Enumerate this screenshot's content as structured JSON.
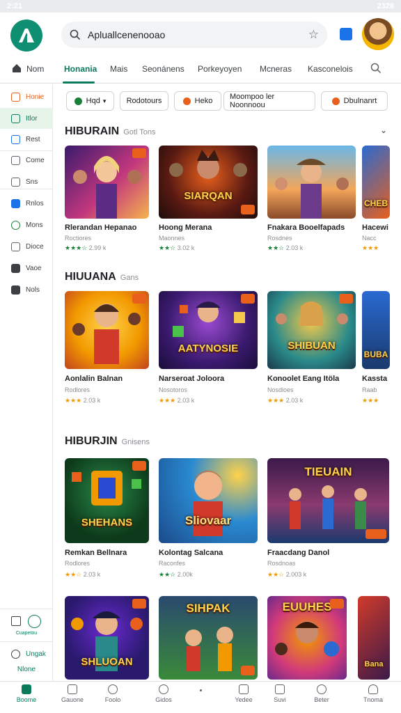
{
  "status": {
    "time": "2:21",
    "right": "2328"
  },
  "search": {
    "placeholder": "Apluallcenenooao"
  },
  "tabs": [
    {
      "label": "Nom"
    },
    {
      "label": "Honania"
    },
    {
      "label": "Mais"
    },
    {
      "label": "Seonánens"
    },
    {
      "label": "Porkeyoyen"
    },
    {
      "label": "Mcneras"
    },
    {
      "label": "Kasconelois"
    }
  ],
  "sidebar": {
    "items": [
      {
        "label": "Honie"
      },
      {
        "label": "Itlor"
      },
      {
        "label": "Rest"
      },
      {
        "label": "Come"
      },
      {
        "label": "Sns"
      },
      {
        "label": "Rnlos"
      },
      {
        "label": "Mons"
      },
      {
        "label": "Dioce"
      },
      {
        "label": "Vaoe"
      },
      {
        "label": "Nols"
      }
    ],
    "footer_top": "Cuapetou",
    "footer_mid": "Ungak",
    "footer_bot": "Nlone"
  },
  "chips": [
    {
      "label": "Hqd"
    },
    {
      "label": "Rodotours"
    },
    {
      "label": "Heko"
    },
    {
      "label": "Moompoo ler Noonnoou"
    },
    {
      "label": "Dbulnanrt"
    }
  ],
  "sections": [
    {
      "title": "HIBURAIN",
      "subtitle": "Gotl Tons",
      "cards": [
        {
          "thumb_text": "",
          "title": "Rlerandan Hepanao",
          "sub": "Roctiores",
          "rating": "2.99 k"
        },
        {
          "thumb_text": "SIARQAN",
          "title": "Hoong Merana",
          "sub": "Maonnes",
          "rating": "3.02 k"
        },
        {
          "thumb_text": "",
          "title": "Fnakara Booelfapads",
          "sub": "Rosdnes",
          "rating": "2.03 k"
        },
        {
          "thumb_text": "CHEB",
          "title": "Hacewi",
          "sub": "Nacc",
          "rating": ""
        }
      ]
    },
    {
      "title": "HIUUANA",
      "subtitle": "Gans",
      "cards": [
        {
          "thumb_text": "",
          "title": "Aonlalin Balnan",
          "sub": "Rodlores",
          "rating": "2.03 k"
        },
        {
          "thumb_text": "AATYNOSIE",
          "title": "Narseroat Joloora",
          "sub": "Nosotoros",
          "rating": "2.03 k"
        },
        {
          "thumb_text": "SHIBUAN",
          "title": "Konoolet Eang Itöla",
          "sub": "Nosdloes",
          "rating": "2.03 k"
        },
        {
          "thumb_text": "BUBA",
          "title": "Kassta",
          "sub": "Raab",
          "rating": ""
        }
      ]
    },
    {
      "title": "HIBURJIN",
      "subtitle": "Gnisens",
      "cards": [
        {
          "thumb_text": "SHEHANS",
          "title": "Remkan Bellnara",
          "sub": "Rodlores",
          "rating": "2.03 k"
        },
        {
          "thumb_text": "Sliovaar",
          "title": "Kolontag Salcana",
          "sub": "Raconfes",
          "rating": "2.00k"
        },
        {
          "thumb_text": "TIEUAIN",
          "title": "Fraacdang Danol",
          "sub": "Rosdnoas",
          "rating": "2.003 k"
        }
      ]
    },
    {
      "title": "",
      "subtitle": "",
      "cards": [
        {
          "thumb_text": "SHLUOAN",
          "title": "",
          "sub": "",
          "rating": ""
        },
        {
          "thumb_text": "SIHPAK",
          "title": "",
          "sub": "",
          "rating": ""
        },
        {
          "thumb_text": "EUUHES",
          "title": "",
          "sub": "",
          "rating": ""
        },
        {
          "thumb_text": "Bana",
          "title": "",
          "sub": "",
          "rating": ""
        }
      ]
    }
  ],
  "bottom_nav": [
    {
      "label": "Boome"
    },
    {
      "label": "Gauone"
    },
    {
      "label": "Foolo"
    },
    {
      "label": "Gidos"
    },
    {
      "label": ""
    },
    {
      "label": "Yedee"
    },
    {
      "label": "Suvi"
    },
    {
      "label": "Beter"
    },
    {
      "label": "Tnoma"
    }
  ],
  "colors": {
    "accent": "#0b7b5e",
    "brand": "#0f8f72",
    "star_green": "#188038",
    "star_orange": "#f29900"
  }
}
